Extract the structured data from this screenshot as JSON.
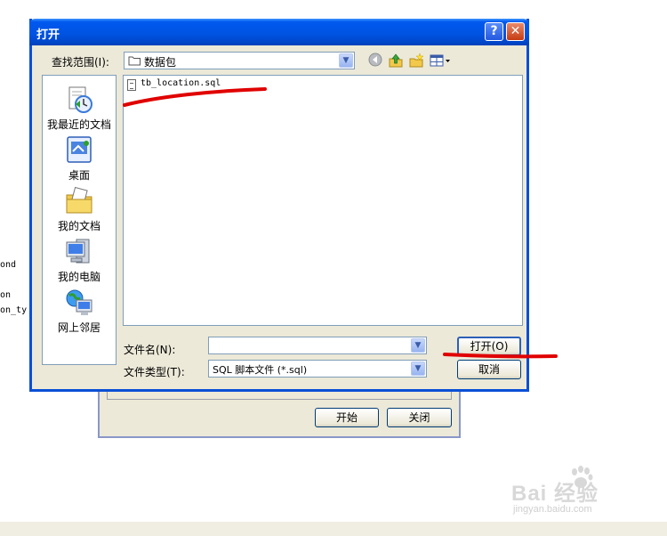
{
  "dialog": {
    "title": "打开",
    "help_label": "?",
    "close_label": "✕"
  },
  "lookin": {
    "label": "查找范围(I):",
    "value": "数据包"
  },
  "places": [
    {
      "label": "我最近的文档",
      "icon": "recent-documents-icon"
    },
    {
      "label": "桌面",
      "icon": "desktop-icon"
    },
    {
      "label": "我的文档",
      "icon": "my-documents-icon"
    },
    {
      "label": "我的电脑",
      "icon": "my-computer-icon"
    },
    {
      "label": "网上邻居",
      "icon": "network-places-icon"
    }
  ],
  "files": [
    {
      "name": "tb_location.sql",
      "icon": "sql-file-icon"
    }
  ],
  "filename": {
    "label": "文件名(N):",
    "value": ""
  },
  "filetype": {
    "label": "文件类型(T):",
    "value": "SQL 脚本文件 (*.sql)"
  },
  "buttons": {
    "open": "打开(O)",
    "cancel": "取消"
  },
  "background": {
    "text_lines": [
      "ond",
      "on",
      "on_ty"
    ],
    "start_button": "开始",
    "close_button": "关闭"
  },
  "watermark": {
    "logo_text": "Bai 经验",
    "url": "jingyan.baidu.com"
  },
  "colors": {
    "titlebar": "#0054e3",
    "dialog_bg": "#ece9d8",
    "annotation": "#e00000"
  }
}
